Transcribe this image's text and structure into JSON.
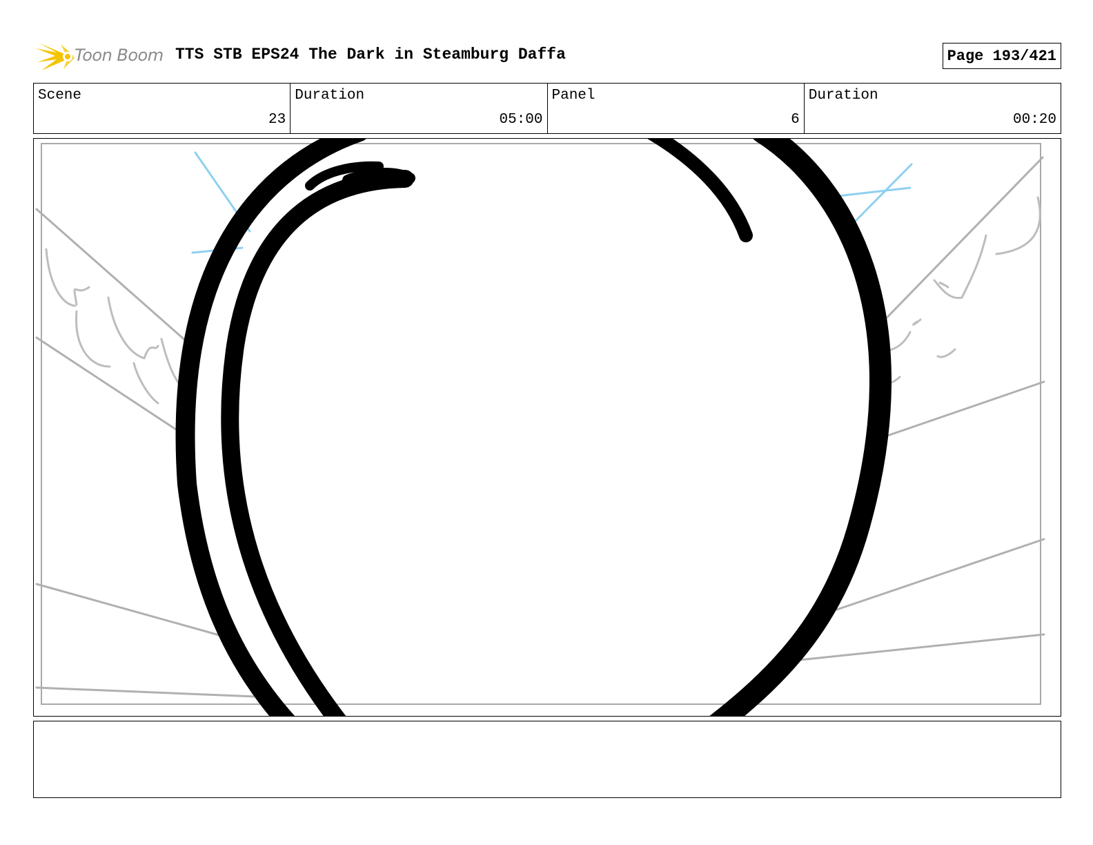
{
  "header": {
    "logo_text": "Toon Boom",
    "title": "TTS STB EPS24 The Dark in Steamburg Daffa",
    "page": "Page 193/421"
  },
  "info": [
    {
      "label": "Scene",
      "value": "23"
    },
    {
      "label": "Duration",
      "value": "05:00"
    },
    {
      "label": "Panel",
      "value": "6"
    },
    {
      "label": "Duration",
      "value": "00:20"
    }
  ],
  "colors": {
    "logo_yellow": "#f5c400",
    "sketch_gray": "#b3b3b3",
    "sketch_blue": "#8fd0f0",
    "ink": "#000000"
  },
  "notes": ""
}
